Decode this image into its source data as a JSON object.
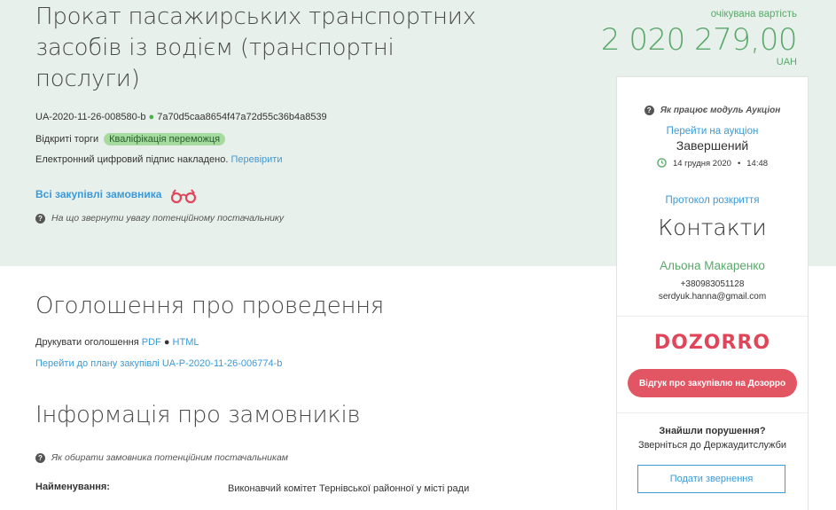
{
  "tender": {
    "title": "Прокат пасажирських транспортних засобів із водієм (транспортні послуги)",
    "id": "UA-2020-11-26-008580-b",
    "hash": "7a70d5caa8654f47a72d55c36b4a8539",
    "procedure": "Відкриті торги",
    "status_badge": "Кваліфікація переможця",
    "signature_text": "Електронний цифровий підпис накладено.",
    "signature_link": "Перевірити",
    "all_purchases_link": "Всі закупівлі замовника",
    "supplier_hint": "На що звернути увагу потенційному постачальнику"
  },
  "price": {
    "label": "очікувана вартість",
    "value": "2 020 279,00",
    "currency": "UAH"
  },
  "panel": {
    "auction_help": "Як працює модуль Аукціон",
    "auction_link": "Перейти на аукціон",
    "auction_status": "Завершений",
    "auction_date": "14 грудня 2020",
    "auction_time": "14:48",
    "protocol_link": "Протокол розкриття",
    "contacts_title": "Контакти",
    "contact_name": "Альона Макаренко",
    "contact_phone": "+380983051128",
    "contact_email": "serdyuk.hanna@gmail.com",
    "dozorro_logo": "DOZORRO",
    "dozorro_button": "Відгук про закупівлю на Дозорро",
    "violations_title": "Знайшли порушення?",
    "violations_text": "Зверніться до Держаудитслужби",
    "submit_button": "Подати звернення"
  },
  "announcement": {
    "heading": "Оголошення про проведення",
    "print_label": "Друкувати оголошення",
    "print_pdf": "PDF",
    "print_html": "HTML",
    "plan_link": "Перейти до плану закупівлі UA-P-2020-11-26-006774-b"
  },
  "customer": {
    "heading": "Інформація про замовників",
    "hint": "Як обирати замовника потенційним постачальникам",
    "name_label": "Найменування:",
    "name_value": "Виконавчий комітет Тернівської районної у місті ради"
  },
  "colors": {
    "hero_bg": "#e8f0ec",
    "price_green": "#5aa86a",
    "link_blue": "#3a9ad9",
    "dozorro_red": "#e0465a"
  }
}
